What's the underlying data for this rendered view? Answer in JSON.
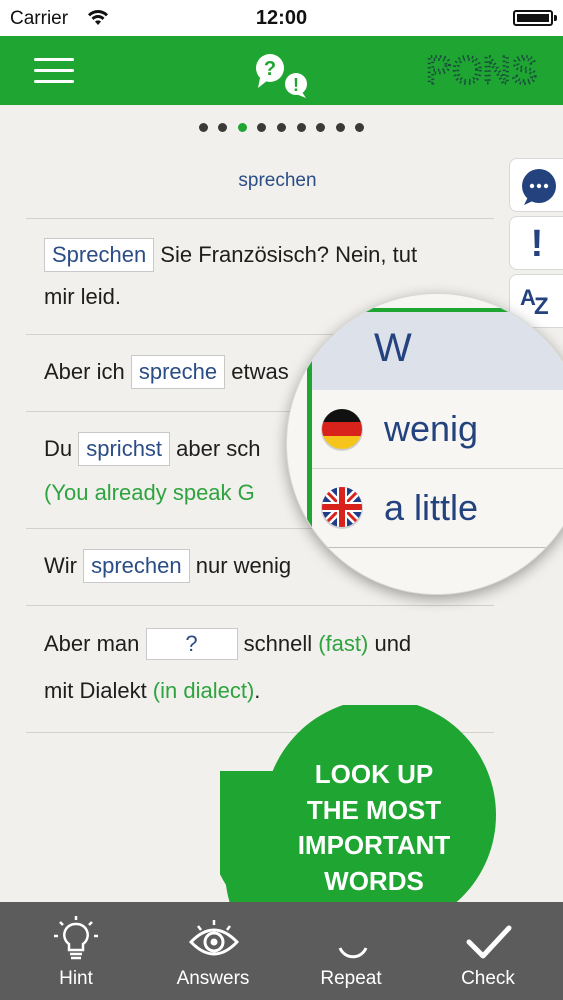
{
  "status_bar": {
    "carrier": "Carrier",
    "time": "12:00"
  },
  "app_bar": {
    "logo_text": "PONS",
    "qa_icon": [
      "?",
      "!"
    ]
  },
  "progress": {
    "total": 9,
    "current": 3
  },
  "word_title": "sprechen",
  "sentences": [
    {
      "line1": {
        "answer": "Sprechen",
        "after": " Sie Französisch? Nein, tut"
      },
      "line2": "mir leid."
    },
    {
      "line1": {
        "before": "Aber ich ",
        "answer": "spreche",
        "after": " etwas"
      }
    },
    {
      "line1": {
        "before": "Du ",
        "answer": "sprichst",
        "after": " aber sch"
      },
      "line2_green": "(You already speak G"
    },
    {
      "line1": {
        "before": "Wir ",
        "answer": "sprechen",
        "after": " nur wenig"
      }
    },
    {
      "line1": {
        "before": "Aber man ",
        "blank": "?",
        "after": " schnell ",
        "hint": "(fast)",
        "after2": " und"
      },
      "line2": {
        "before": "mit Dialekt ",
        "hint": "(in dialect)",
        "after": "."
      }
    }
  ],
  "side_tabs": [
    {
      "icon": "chat-bubble-icon",
      "active": true
    },
    {
      "icon": "exclamation-icon",
      "symbol": "!"
    },
    {
      "icon": "az-dictionary-icon",
      "symbol_a": "A",
      "symbol_z": "Z"
    }
  ],
  "magnifier": {
    "letter": "W",
    "entries": [
      {
        "flag": "german-flag-icon",
        "word": "wenig"
      },
      {
        "flag": "uk-flag-icon",
        "word": "a little"
      }
    ]
  },
  "promo_lines": [
    "LOOK UP",
    "THE MOST",
    "IMPORTANT",
    "WORDS"
  ],
  "bottom_tabs": [
    {
      "label": "Hint",
      "icon": "lightbulb-icon"
    },
    {
      "label": "Answers",
      "icon": "eye-icon"
    },
    {
      "label": "Repeat",
      "icon": "repeat-icon"
    },
    {
      "label": "Check",
      "icon": "checkmark-icon"
    }
  ],
  "colors": {
    "brand_green": "#1fa532",
    "answer_blue": "#2b4d86",
    "hint_green": "#2ea33f",
    "bottom_bar": "#5c5c5c"
  }
}
